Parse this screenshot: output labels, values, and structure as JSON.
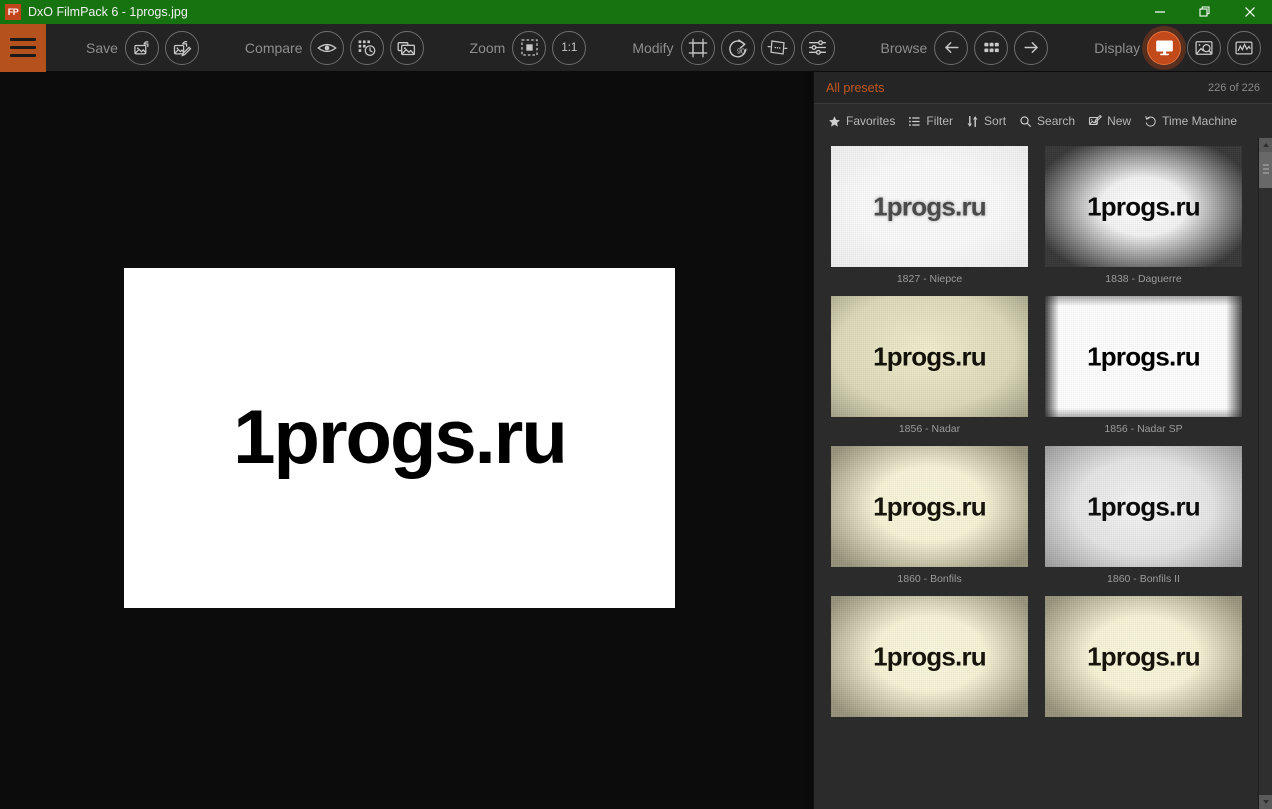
{
  "titlebar": {
    "app_icon_text": "FP",
    "title": "DxO FilmPack 6 - 1progs.jpg",
    "controls": [
      {
        "name": "minimize",
        "label": "—"
      },
      {
        "name": "restore",
        "label": "❐"
      },
      {
        "name": "close",
        "label": "✕"
      }
    ],
    "background_color": "#17730f"
  },
  "toolbar": {
    "menu_icon": "hamburger-icon",
    "accent_color": "#b4511d",
    "groups": [
      {
        "label": "Save",
        "buttons": [
          {
            "icon": "export-image-icon",
            "label": "Export image"
          },
          {
            "icon": "export-edit-image-icon",
            "label": "Export and edit image"
          }
        ]
      },
      {
        "label": "Compare",
        "buttons": [
          {
            "icon": "eye-compare-icon",
            "label": "Compare original"
          },
          {
            "icon": "history-compare-icon",
            "label": "Compare history"
          },
          {
            "icon": "side-by-side-icon",
            "label": "Side by side"
          }
        ]
      },
      {
        "label": "Zoom",
        "buttons": [
          {
            "icon": "fit-to-screen-icon",
            "label": "Fit to screen"
          },
          {
            "icon": "one-to-one-icon",
            "label": "1:1"
          }
        ]
      },
      {
        "label": "Modify",
        "buttons": [
          {
            "icon": "crop-icon",
            "label": "Crop"
          },
          {
            "icon": "rotate-90-icon",
            "label": "Rotate 90°"
          },
          {
            "icon": "perspective-icon",
            "label": "Perspective"
          },
          {
            "icon": "sliders-icon",
            "label": "Settings"
          }
        ]
      },
      {
        "label": "Browse",
        "buttons": [
          {
            "icon": "arrow-left-icon",
            "label": "Previous image"
          },
          {
            "icon": "grid-icon",
            "label": "Browser"
          },
          {
            "icon": "arrow-right-icon",
            "label": "Next image"
          }
        ]
      },
      {
        "label": "Display",
        "buttons": [
          {
            "icon": "monitor-icon",
            "label": "Image display",
            "active": true
          },
          {
            "icon": "loupe-icon",
            "label": "Loupe"
          },
          {
            "icon": "histogram-icon",
            "label": "Histogram"
          }
        ]
      }
    ],
    "zoom_ratio_label": "1:1",
    "rotate_degrees_label": "90°"
  },
  "canvas": {
    "image_text": "1progs.ru",
    "background_color": "#0c0c0c",
    "photo_background": "#ffffff"
  },
  "panel": {
    "title": "All presets",
    "count": "226 of 226",
    "title_color": "#c1561f",
    "tools": [
      {
        "icon": "star-icon",
        "label": "Favorites"
      },
      {
        "icon": "list-filter-icon",
        "label": "Filter"
      },
      {
        "icon": "sort-arrows-icon",
        "label": "Sort"
      },
      {
        "icon": "search-icon",
        "label": "Search"
      },
      {
        "icon": "new-preset-icon",
        "label": "New"
      },
      {
        "icon": "time-machine-icon",
        "label": "Time Machine"
      }
    ],
    "preset_thumbnail_text": "1progs.ru",
    "presets": [
      {
        "caption": "1827 - Niepce",
        "style": "st-niepce"
      },
      {
        "caption": "1838 - Daguerre",
        "style": "st-daguerre"
      },
      {
        "caption": "1856 - Nadar",
        "style": "st-nadar"
      },
      {
        "caption": "1856 - Nadar SP",
        "style": "st-nadarsp"
      },
      {
        "caption": "1860 - Bonfils",
        "style": "st-bonfils"
      },
      {
        "caption": "1860 - Bonfils II",
        "style": "st-bonfils2"
      },
      {
        "caption": "",
        "style": "st-bonfils"
      },
      {
        "caption": "",
        "style": "st-bonfils"
      }
    ]
  }
}
